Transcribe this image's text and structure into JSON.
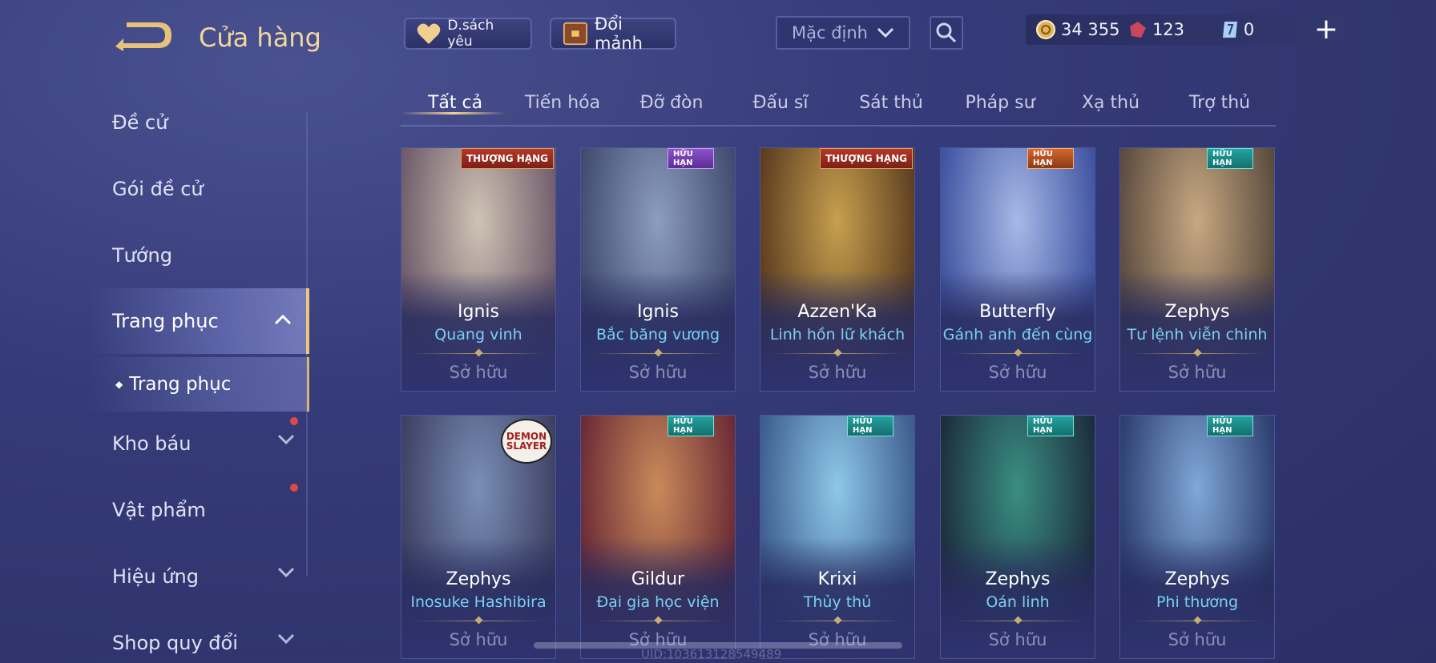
{
  "header": {
    "title": "Cửa hàng",
    "favorites_label": "D.sách yêu",
    "exchange_label": "Đổi mảnh",
    "sort": {
      "selected": "Mặc định"
    },
    "currency": {
      "gold": "34 355",
      "gems": "123",
      "vouchers": "0"
    }
  },
  "sidebar": {
    "items": [
      {
        "label": "Đề cử"
      },
      {
        "label": "Gói đề cử"
      },
      {
        "label": "Tướng"
      },
      {
        "label": "Trang phục"
      },
      {
        "label": "Kho báu"
      },
      {
        "label": "Vật phẩm"
      },
      {
        "label": "Hiệu ứng"
      },
      {
        "label": "Shop quy đổi"
      }
    ],
    "sub_item": "Trang phục"
  },
  "tabs": [
    "Tất cả",
    "Tiến hóa",
    "Đỡ đòn",
    "Đấu sĩ",
    "Sát thủ",
    "Pháp sư",
    "Xạ thủ",
    "Trợ thủ"
  ],
  "badges": {
    "rank": "THƯỢNG HẠNG",
    "limited": "HỮU HẠN",
    "limited_a": "A",
    "demon_slayer": "DEMON SLAYER"
  },
  "cards": [
    {
      "name": "Ignis",
      "skin": "Quang vinh",
      "status": "Sở hữu",
      "badge": "rank",
      "c1": "#cfc3b4",
      "c2": "#6e5a6a"
    },
    {
      "name": "Ignis",
      "skin": "Bắc băng vương",
      "status": "Sở hữu",
      "badge": "limit-purple",
      "c1": "#8c9dc0",
      "c2": "#3f4a6e"
    },
    {
      "name": "Azzen'Ka",
      "skin": "Linh hồn lữ khách",
      "status": "Sở hữu",
      "badge": "rank",
      "c1": "#c79f4e",
      "c2": "#5a3c20"
    },
    {
      "name": "Butterfly",
      "skin": "Gánh anh đến cùng",
      "status": "Sở hữu",
      "badge": "limit-orange",
      "c1": "#a7b8e6",
      "c2": "#3e52a0"
    },
    {
      "name": "Zephys",
      "skin": "Tư lệnh viễn chinh",
      "status": "Sở hữu",
      "badge": "limit",
      "c1": "#c8a882",
      "c2": "#5a4a3e"
    },
    {
      "name": "Zephys",
      "skin": "Inosuke Hashibira",
      "status": "Sở hữu",
      "badge": "ds",
      "c1": "#7a8fb8",
      "c2": "#3c3f60"
    },
    {
      "name": "Gildur",
      "skin": "Đại gia học viện",
      "status": "Sở hữu",
      "badge": "limit",
      "c1": "#c98a5a",
      "c2": "#6a2a36"
    },
    {
      "name": "Krixi",
      "skin": "Thủy thủ",
      "status": "Sở hữu",
      "badge": "limit",
      "c1": "#8ec8e8",
      "c2": "#3c5c8e"
    },
    {
      "name": "Zephys",
      "skin": "Oán linh",
      "status": "Sở hữu",
      "badge": "limit",
      "c1": "#3a8e82",
      "c2": "#1c2c3c"
    },
    {
      "name": "Zephys",
      "skin": "Phi thương",
      "status": "Sở hữu",
      "badge": "limit",
      "c1": "#7fa8d8",
      "c2": "#2c3c6e"
    }
  ],
  "watermark": "UID:103613128549489",
  "colors": {
    "accent_gold": "#f1d79a",
    "skin_text": "#7ad0f2",
    "background": "#353b78"
  }
}
